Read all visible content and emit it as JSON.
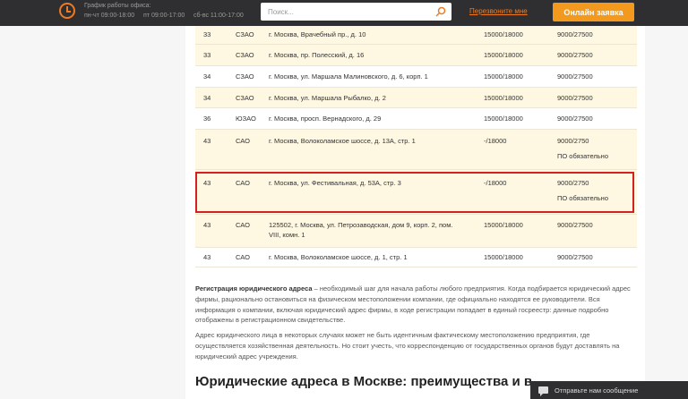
{
  "header": {
    "schedule_title": "График работы офиса:",
    "schedule": [
      "пн-чт 09:00-18:00",
      "пт 09:00-17:00",
      "сб-вс 11:00-17:00"
    ],
    "search_placeholder": "Поиск...",
    "callback_label": "Перезвоните мне",
    "online_button_label": "Онлайн заявка",
    "accent_color": "#ee7a22"
  },
  "table": {
    "rows": [
      {
        "num": "33",
        "district": "СЗАО",
        "address": "г. Москва, Врачебный пр., д. 10",
        "price1": "15000/18000",
        "price2": "9000/27500",
        "note": ""
      },
      {
        "num": "33",
        "district": "СЗАО",
        "address": "г. Москва, пр. Полесский, д. 16",
        "price1": "15000/18000",
        "price2": "9000/27500",
        "note": ""
      },
      {
        "num": "34",
        "district": "СЗАО",
        "address": "г. Москва, ул. Маршала Малиновского, д. 6, корп. 1",
        "price1": "15000/18000",
        "price2": "9000/27500",
        "note": ""
      },
      {
        "num": "34",
        "district": "СЗАО",
        "address": "г. Москва, ул. Маршала Рыбалко, д. 2",
        "price1": "15000/18000",
        "price2": "9000/27500",
        "note": ""
      },
      {
        "num": "36",
        "district": "ЮЗАО",
        "address": "г. Москва, просп. Вернадского, д. 29",
        "price1": "15000/18000",
        "price2": "9000/27500",
        "note": ""
      },
      {
        "num": "43",
        "district": "САО",
        "address": "г. Москва, Волоколамское шоссе, д. 13А, стр. 1",
        "price1": "-/18000",
        "price2": "9000/2750",
        "note": "ПО обязательно"
      },
      {
        "num": "43",
        "district": "САО",
        "address": "г. Москва, ул. Фестивальная, д. 53А, стр. 3",
        "price1": "-/18000",
        "price2": "9000/2750",
        "note": "ПО обязательно"
      },
      {
        "num": "43",
        "district": "САО",
        "address": "125502, г. Москва, ул. Петрозаводская, дом 9, корп. 2, пом. VIII, комн. 1",
        "price1": "15000/18000",
        "price2": "9000/27500",
        "note": ""
      },
      {
        "num": "43",
        "district": "САО",
        "address": "г. Москва, Волоколамское шоссе, д. 1, стр. 1",
        "price1": "15000/18000",
        "price2": "9000/27500",
        "note": ""
      }
    ]
  },
  "article": {
    "para1_bold": "Регистрация юридического адреса",
    "para1_rest": " – необходимый шаг для начала работы любого предприятия. Когда подбирается юридический адрес фирмы, рационально остановиться на физическом местоположении компании, где официально находятся ее руководители. Вся информация о компании, включая юридический адрес фирмы, в ходе регистрации попадает в единый госреестр: данные подробно отображены в регистрационном свидетельстве.",
    "para2": "Адрес юридического лица в некоторых случаях может не быть идентичным фактическому местоположению предприятия, где осуществляется хозяйственная деятельность. Но стоит учесть, что корреспонденцию от государственных органов будут доставлять на юридический адрес учреждения.",
    "heading": "Юридические адреса в Москве: преимущества и возможно"
  },
  "chat": {
    "label": "Отправьте нам сообщение"
  }
}
